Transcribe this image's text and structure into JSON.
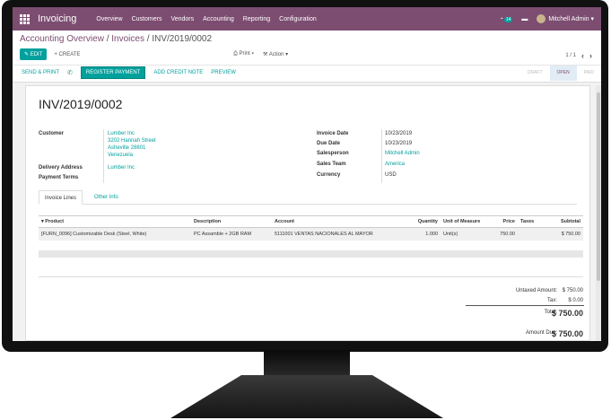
{
  "topbar": {
    "app_name": "Invoicing",
    "menu": [
      "Overview",
      "Customers",
      "Vendors",
      "Accounting",
      "Reporting",
      "Configuration"
    ],
    "chat_badge": "14",
    "user": "Mitchell Admin"
  },
  "breadcrumb": {
    "root": "Accounting Overview",
    "mid": "Invoices",
    "current": "INV/2019/0002"
  },
  "control": {
    "edit": "EDIT",
    "create": "CREATE",
    "print": "Print",
    "action": "Action",
    "pager": "1 / 1"
  },
  "statusbar": {
    "send_print": "SEND & PRINT",
    "register_payment": "REGISTER PAYMENT",
    "add_credit_note": "ADD CREDIT NOTE",
    "preview": "PREVIEW",
    "stages": [
      "DRAFT",
      "OPEN",
      "PAID"
    ]
  },
  "invoice": {
    "number": "INV/2019/0002",
    "labels": {
      "customer": "Customer",
      "delivery": "Delivery Address",
      "payment_terms": "Payment Terms",
      "invoice_date": "Invoice Date",
      "due_date": "Due Date",
      "salesperson": "Salesperson",
      "sales_team": "Sales Team",
      "currency": "Currency"
    },
    "customer_lines": [
      "Lumber Inc",
      "3202 Hannah Street",
      "Asheville 28801",
      "Venezuela"
    ],
    "delivery": "Lumber Inc",
    "invoice_date": "10/23/2019",
    "due_date": "10/23/2019",
    "salesperson": "Mitchell Admin",
    "sales_team": "America",
    "currency": "USD"
  },
  "tabs": [
    "Invoice Lines",
    "Other Info"
  ],
  "lines": {
    "headers": [
      "Product",
      "Description",
      "Account",
      "Quantity",
      "Unit of Measure",
      "Price",
      "Taxes",
      "Subtotal"
    ],
    "rows": [
      [
        "[FURN_0096] Customizable Desk (Steel, White)",
        "PC Assamble + 2GB RAM",
        "5111001 VENTAS NACIONALES AL MAYOR",
        "1.000",
        "Unit(s)",
        "750.00",
        "",
        "$ 750.00"
      ]
    ]
  },
  "totals": {
    "untaxed_label": "Untaxed Amount:",
    "untaxed": "$ 750.00",
    "tax_label": "Tax:",
    "tax": "$ 0.00",
    "total_label": "Total:",
    "total": "$ 750.00",
    "due_label": "Amount Due:",
    "due": "$ 750.00"
  },
  "colors": {
    "brand": "#7c4d71",
    "accent": "#00a09d"
  }
}
